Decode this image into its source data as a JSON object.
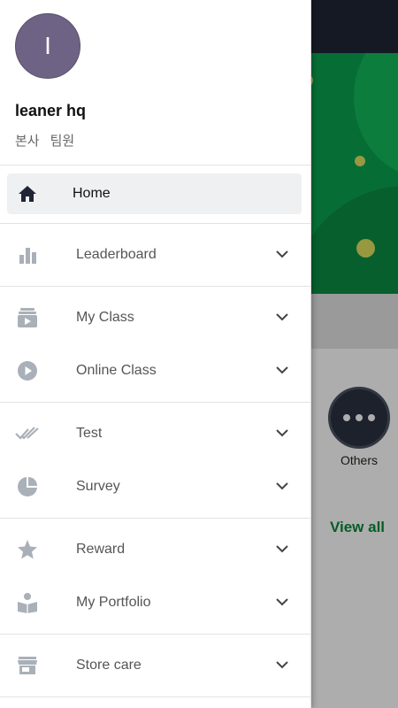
{
  "background": {
    "others_label": "Others",
    "view_all_label": "View all"
  },
  "drawer": {
    "profile": {
      "avatar_letter": "I",
      "name": "leaner hq",
      "org": "본사",
      "role": "팀원"
    },
    "home": {
      "label": "Home",
      "icon": "home-icon"
    },
    "sections": [
      {
        "items": [
          {
            "label": "Leaderboard",
            "icon": "bar-chart-icon"
          }
        ]
      },
      {
        "items": [
          {
            "label": "My Class",
            "icon": "video-library-icon"
          },
          {
            "label": "Online Class",
            "icon": "play-circle-icon"
          }
        ]
      },
      {
        "items": [
          {
            "label": "Test",
            "icon": "double-check-icon"
          },
          {
            "label": "Survey",
            "icon": "pie-chart-icon"
          }
        ]
      },
      {
        "items": [
          {
            "label": "Reward",
            "icon": "star-icon"
          },
          {
            "label": "My Portfolio",
            "icon": "portfolio-icon"
          }
        ]
      },
      {
        "items": [
          {
            "label": "Store care",
            "icon": "store-icon"
          }
        ]
      }
    ]
  },
  "colors": {
    "accent_green": "#0a8a3a",
    "banner_green": "#0aa34f",
    "avatar_purple": "#6e6384",
    "icon_gray": "#a9b0b8"
  }
}
